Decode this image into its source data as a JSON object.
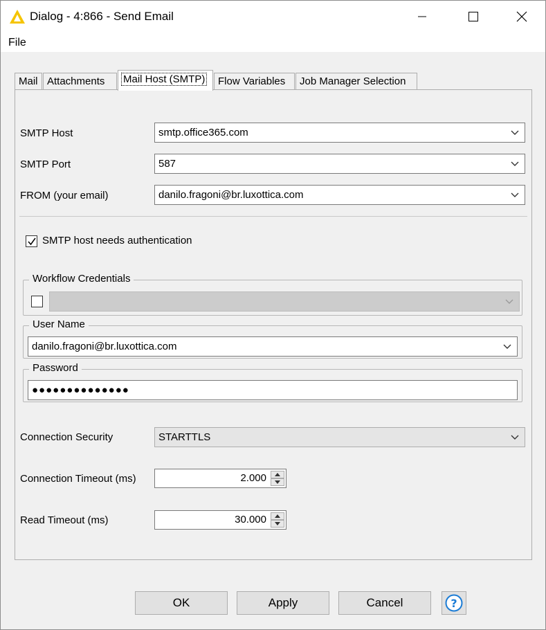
{
  "window": {
    "title": "Dialog - 4:866 - Send Email"
  },
  "menu": {
    "file": "File"
  },
  "tabs": [
    {
      "label": "Mail"
    },
    {
      "label": "Attachments"
    },
    {
      "label": "Mail Host (SMTP)"
    },
    {
      "label": "Flow Variables"
    },
    {
      "label": "Job Manager Selection"
    }
  ],
  "smtp": {
    "host_label": "SMTP Host",
    "host_value": "smtp.office365.com",
    "port_label": "SMTP Port",
    "port_value": "587",
    "from_label": "FROM (your email)",
    "from_value": "danilo.fragoni@br.luxottica.com"
  },
  "auth": {
    "checkbox_label": "SMTP host needs authentication",
    "checked": true
  },
  "workflow_credentials": {
    "title": "Workflow Credentials",
    "value": ""
  },
  "user_name": {
    "title": "User Name",
    "value": "danilo.fragoni@br.luxottica.com"
  },
  "password": {
    "title": "Password",
    "masked_value": "●●●●●●●●●●●●●●"
  },
  "connection": {
    "security_label": "Connection Security",
    "security_value": "STARTTLS",
    "timeout_label": "Connection Timeout (ms)",
    "timeout_value": "2.000",
    "read_timeout_label": "Read Timeout (ms)",
    "read_timeout_value": "30.000"
  },
  "buttons": {
    "ok": "OK",
    "apply": "Apply",
    "cancel": "Cancel"
  },
  "colors": {
    "accent_warning": "#f5c400",
    "help_blue": "#1c7cd5"
  }
}
